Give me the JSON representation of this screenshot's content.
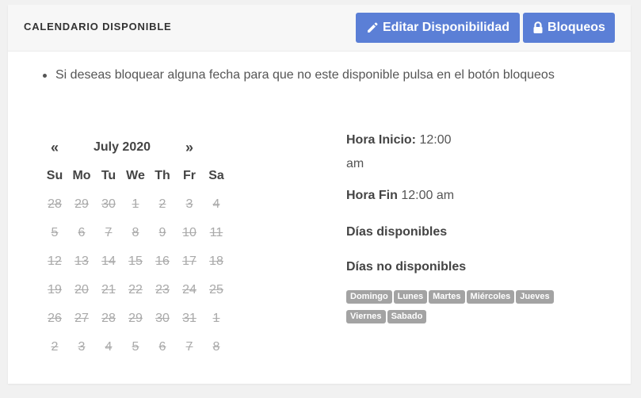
{
  "header": {
    "title": "CALENDARIO DISPONIBLE",
    "edit_button": "Editar Disponibilidad",
    "lock_button": "Bloqueos"
  },
  "notes": {
    "items": [
      "Si deseas bloquear alguna fecha para que no este disponible pulsa en el botón bloqueos"
    ]
  },
  "calendar": {
    "prev": "«",
    "next": "»",
    "month": "July 2020",
    "weekdays": [
      "Su",
      "Mo",
      "Tu",
      "We",
      "Th",
      "Fr",
      "Sa"
    ],
    "weeks": [
      [
        "28",
        "29",
        "30",
        "1",
        "2",
        "3",
        "4"
      ],
      [
        "5",
        "6",
        "7",
        "8",
        "9",
        "10",
        "11"
      ],
      [
        "12",
        "13",
        "14",
        "15",
        "16",
        "17",
        "18"
      ],
      [
        "19",
        "20",
        "21",
        "22",
        "23",
        "24",
        "25"
      ],
      [
        "26",
        "27",
        "28",
        "29",
        "30",
        "31",
        "1"
      ],
      [
        "2",
        "3",
        "4",
        "5",
        "6",
        "7",
        "8"
      ]
    ]
  },
  "info": {
    "start_label": "Hora Inicio:",
    "start_value": "12:00",
    "start_value_cont": "am",
    "end_label": "Hora Fin",
    "end_value": "12:00 am",
    "available_label": "Días disponibles",
    "unavailable_label": "Días no disponibles",
    "unavailable_days": [
      "Domingo",
      "Lunes",
      "Martes",
      "Miércoles",
      "Jueves",
      "Viernes",
      "Sabado"
    ]
  },
  "colors": {
    "accent": "#5b7fd6",
    "badge": "#a3a3a3",
    "disabled_day": "#aaaaaa"
  }
}
